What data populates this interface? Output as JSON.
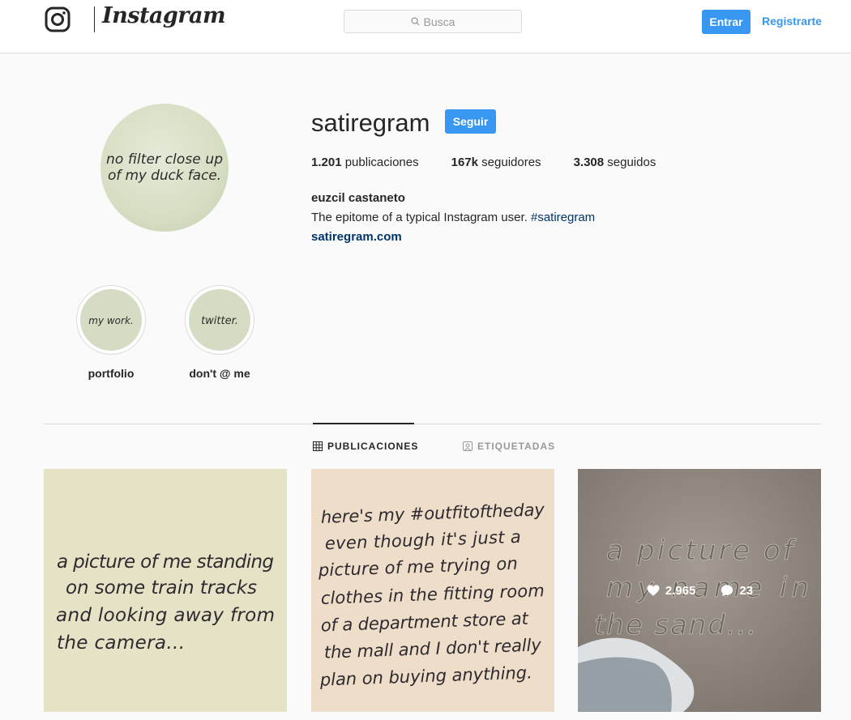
{
  "header": {
    "logo_text": "Instagram",
    "search_placeholder": "Busca",
    "login_label": "Entrar",
    "register_label": "Registrarte"
  },
  "profile": {
    "username": "satiregram",
    "follow_label": "Seguir",
    "avatar_text": [
      "no filter close up",
      "of my duck face."
    ],
    "stats": {
      "posts_count": "1.201",
      "posts_label": "publicaciones",
      "followers_count": "167k",
      "followers_label": "seguidores",
      "following_count": "3.308",
      "following_label": "seguidos"
    },
    "full_name": "euzcil castaneto",
    "bio_text": "The epitome of a typical Instagram user.",
    "bio_hashtag": "#satiregram",
    "website": "satiregram.com"
  },
  "highlights": [
    {
      "cover_text": "my work.",
      "label": "portfolio"
    },
    {
      "cover_text": "twitter.",
      "label": "don't @ me"
    }
  ],
  "tabs": {
    "posts_label": "PUBLICACIONES",
    "tagged_label": "ETIQUETADAS"
  },
  "posts": [
    {
      "lines": [
        "a picture of me standing",
        "on some train tracks",
        "and looking away from",
        "the camera..."
      ]
    },
    {
      "lines": [
        "here's my #outfitoftheday",
        "even though it's just a",
        "picture of me trying on",
        "clothes in the fitting room",
        "of a department store at",
        "the mall and I don't really",
        "plan on buying anything."
      ]
    },
    {
      "lines": [
        "a picture of",
        "my name in",
        "the sand..."
      ],
      "likes": "2.965",
      "comments": "23"
    }
  ],
  "colors": {
    "accent": "#3897f0",
    "link": "#003569",
    "border": "#dbdbdb",
    "background": "#fafafa"
  },
  "icons": [
    "instagram-glyph-icon",
    "search-icon",
    "grid-icon",
    "tagged-icon",
    "heart-icon",
    "comment-icon"
  ]
}
